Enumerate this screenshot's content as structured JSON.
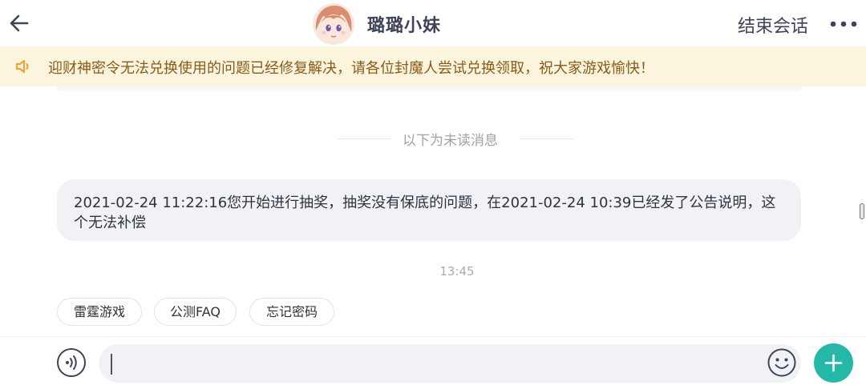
{
  "header": {
    "title": "璐璐小妹",
    "end_session_label": "结束会话"
  },
  "notice": {
    "text": "迎财神密令无法兑换使用的问题已经修复解决，请各位封魔人尝试兑换领取，祝大家游戏愉快！"
  },
  "chat": {
    "divider_label": "以下为未读消息",
    "message": "2021-02-24 11:22:16您开始进行抽奖，抽奖没有保底的问题，在2021-02-24 10:39已经发了公告说明，这个无法补偿",
    "timestamp": "13:45"
  },
  "quick_replies": [
    {
      "label": "雷霆游戏"
    },
    {
      "label": "公测FAQ"
    },
    {
      "label": "忘记密码"
    }
  ],
  "input": {
    "value": "",
    "placeholder": ""
  },
  "icons": {
    "back": "back-arrow-icon",
    "more": "more-dots-icon",
    "notice": "speaker-icon",
    "voice": "voice-icon",
    "emoji": "emoji-icon",
    "plus": "plus-icon"
  },
  "colors": {
    "accent": "#26b8a7",
    "notice_bg": "#fcf5de",
    "notice_text": "#8a5a19",
    "notice_icon": "#f0a23a",
    "bubble_bg": "#f1f2f5",
    "title": "#3f4359"
  }
}
